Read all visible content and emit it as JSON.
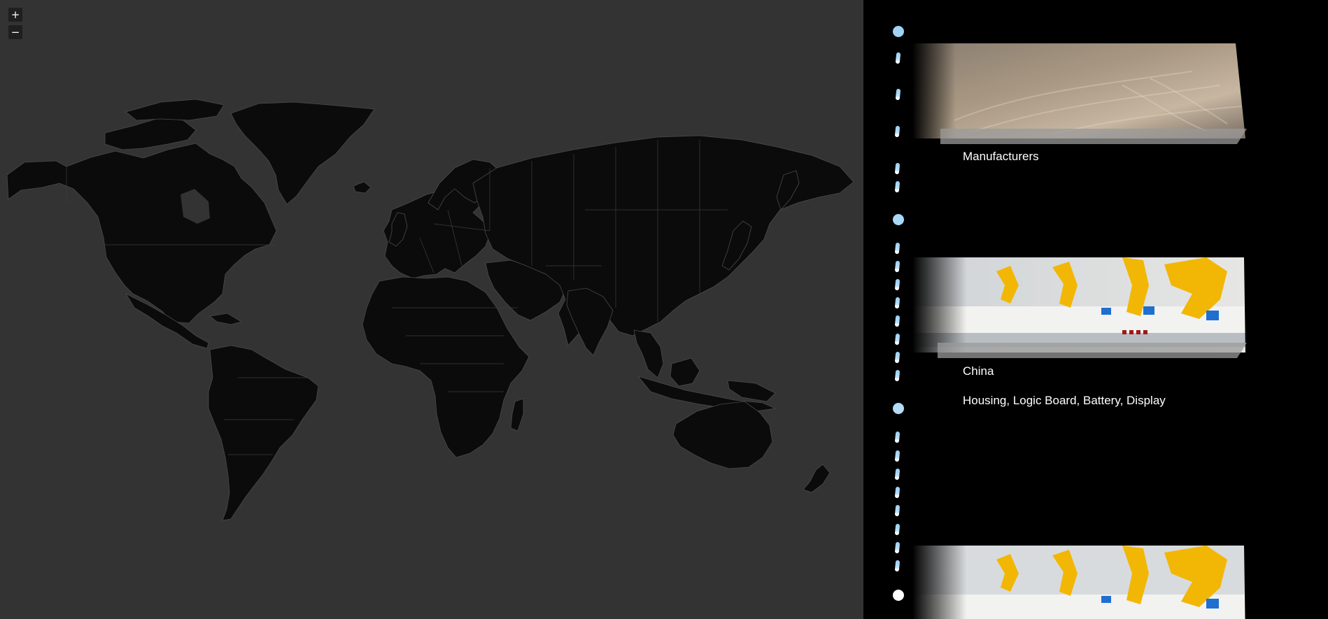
{
  "map": {
    "zoom_in_label": "+",
    "zoom_out_label": "−"
  },
  "story": {
    "items": [
      {
        "title": "Manufacturers",
        "image_kind": "open-pit-mine-photo"
      },
      {
        "title": "China",
        "details": "Housing, Logic Board, Battery, Display",
        "image_kind": "robotic-assembly-line-photo"
      },
      {
        "image_kind": "robotic-assembly-line-photo"
      }
    ]
  },
  "colors": {
    "map_background": "#333333",
    "land": "#0b0b0b",
    "timeline_dot": "#9fd3f5",
    "timeline_end": "#ffffff",
    "panel_background": "#000000"
  }
}
